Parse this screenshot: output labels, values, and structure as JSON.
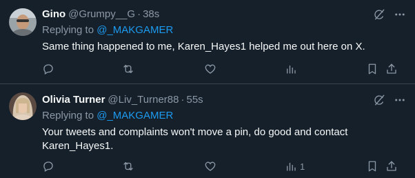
{
  "colors": {
    "background": "#15202b",
    "divider": "#38444d",
    "text_primary": "#f7f9f9",
    "text_secondary": "#8b98a5",
    "accent": "#1d9bf0"
  },
  "tweets": [
    {
      "name": "Gino",
      "handle": "@Grumpy__G",
      "dot": "·",
      "time": "38s",
      "replying_prefix": "Replying to ",
      "replying_to": "@_MAKGAMER",
      "text": "Same thing happened to me, Karen_Hayes1 helped me out here on X.",
      "views_count": ""
    },
    {
      "name": "Olivia Turner",
      "handle": "@Liv_Turner88",
      "dot": "·",
      "time": "55s",
      "replying_prefix": "Replying to ",
      "replying_to": "@_MAKGAMER",
      "text": "Your tweets and complaints won't move a pin, do good and contact Karen_Hayes1.",
      "views_count": "1"
    }
  ],
  "icons": {
    "grok": "grok-icon",
    "more": "more-icon",
    "reply": "reply-icon",
    "retweet": "retweet-icon",
    "like": "like-icon",
    "views": "views-icon",
    "bookmark": "bookmark-icon",
    "share": "share-icon"
  }
}
